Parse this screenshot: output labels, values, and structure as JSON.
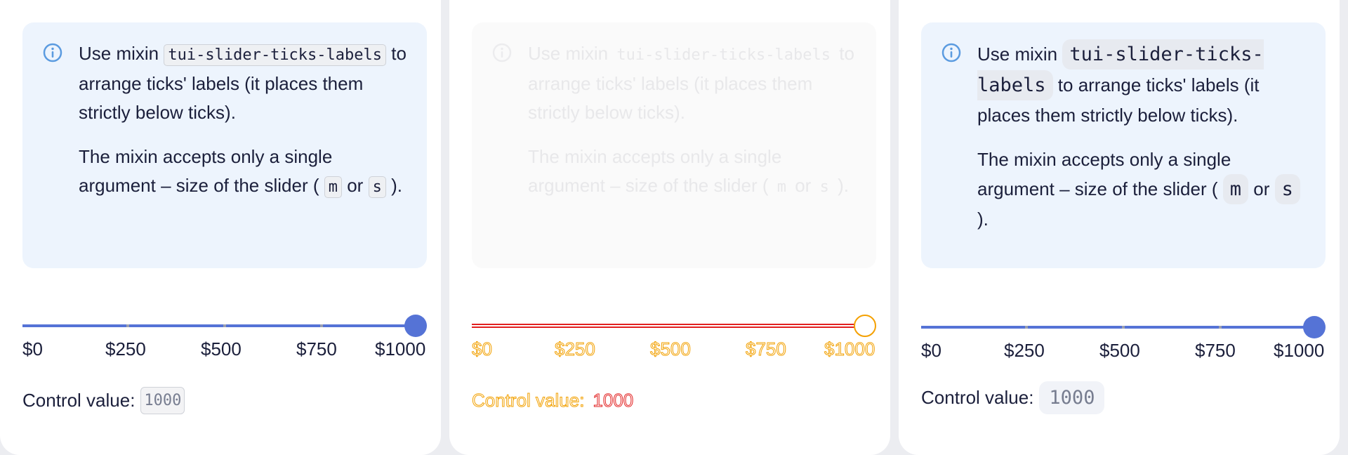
{
  "panels": [
    {
      "note": {
        "p1_prefix": "Use mixin",
        "p1_code": "tui-slider-ticks-labels",
        "p1_suffix": "to arrange ticks' labels (it places them strictly below ticks).",
        "p2_prefix": "The mixin accepts only a single argument – size of the slider (",
        "p2_code_m": "m",
        "p2_or": "or",
        "p2_code_s": "s",
        "p2_suffix": ")."
      },
      "slider": {
        "value": 1000,
        "min": 0,
        "max": 1000
      },
      "tick_labels": [
        "$0",
        "$250",
        "$500",
        "$750",
        "$1000"
      ],
      "control_label": "Control value:",
      "control_value": "1000"
    },
    {
      "note": {
        "p1_prefix": "Use mixin",
        "p1_code": "tui-slider-ticks-labels",
        "p1_suffix": "to arrange ticks' labels (it places them strictly below ticks).",
        "p2_prefix": "The mixin accepts only a single argument – size of the slider (",
        "p2_code_m": "m",
        "p2_or": "or",
        "p2_code_s": "s",
        "p2_suffix": ")."
      },
      "slider": {
        "value": 1000,
        "min": 0,
        "max": 1000
      },
      "tick_labels": [
        "$0",
        "$250",
        "$500",
        "$750",
        "$1000"
      ],
      "control_label": "Control value:",
      "control_value": "1000"
    },
    {
      "note": {
        "p1_prefix": "Use mixin",
        "p1_code": "tui-slider-ticks-labels",
        "p1_suffix": "to arrange ticks' labels (it places them strictly below ticks).",
        "p2_prefix": "The mixin accepts only a single argument – size of the slider (",
        "p2_code_m": "m",
        "p2_or": "or",
        "p2_code_s": "s",
        "p2_suffix": ")."
      },
      "slider": {
        "value": 1000,
        "min": 0,
        "max": 1000
      },
      "tick_labels": [
        "$0",
        "$250",
        "$500",
        "$750",
        "$1000"
      ],
      "control_label": "Control value:",
      "control_value": "1000"
    }
  ],
  "colors": {
    "accent": "#5573d6",
    "note_bg": "#edf4fd",
    "diff_red": "#e21f1f",
    "diff_orange": "#f2a000"
  }
}
